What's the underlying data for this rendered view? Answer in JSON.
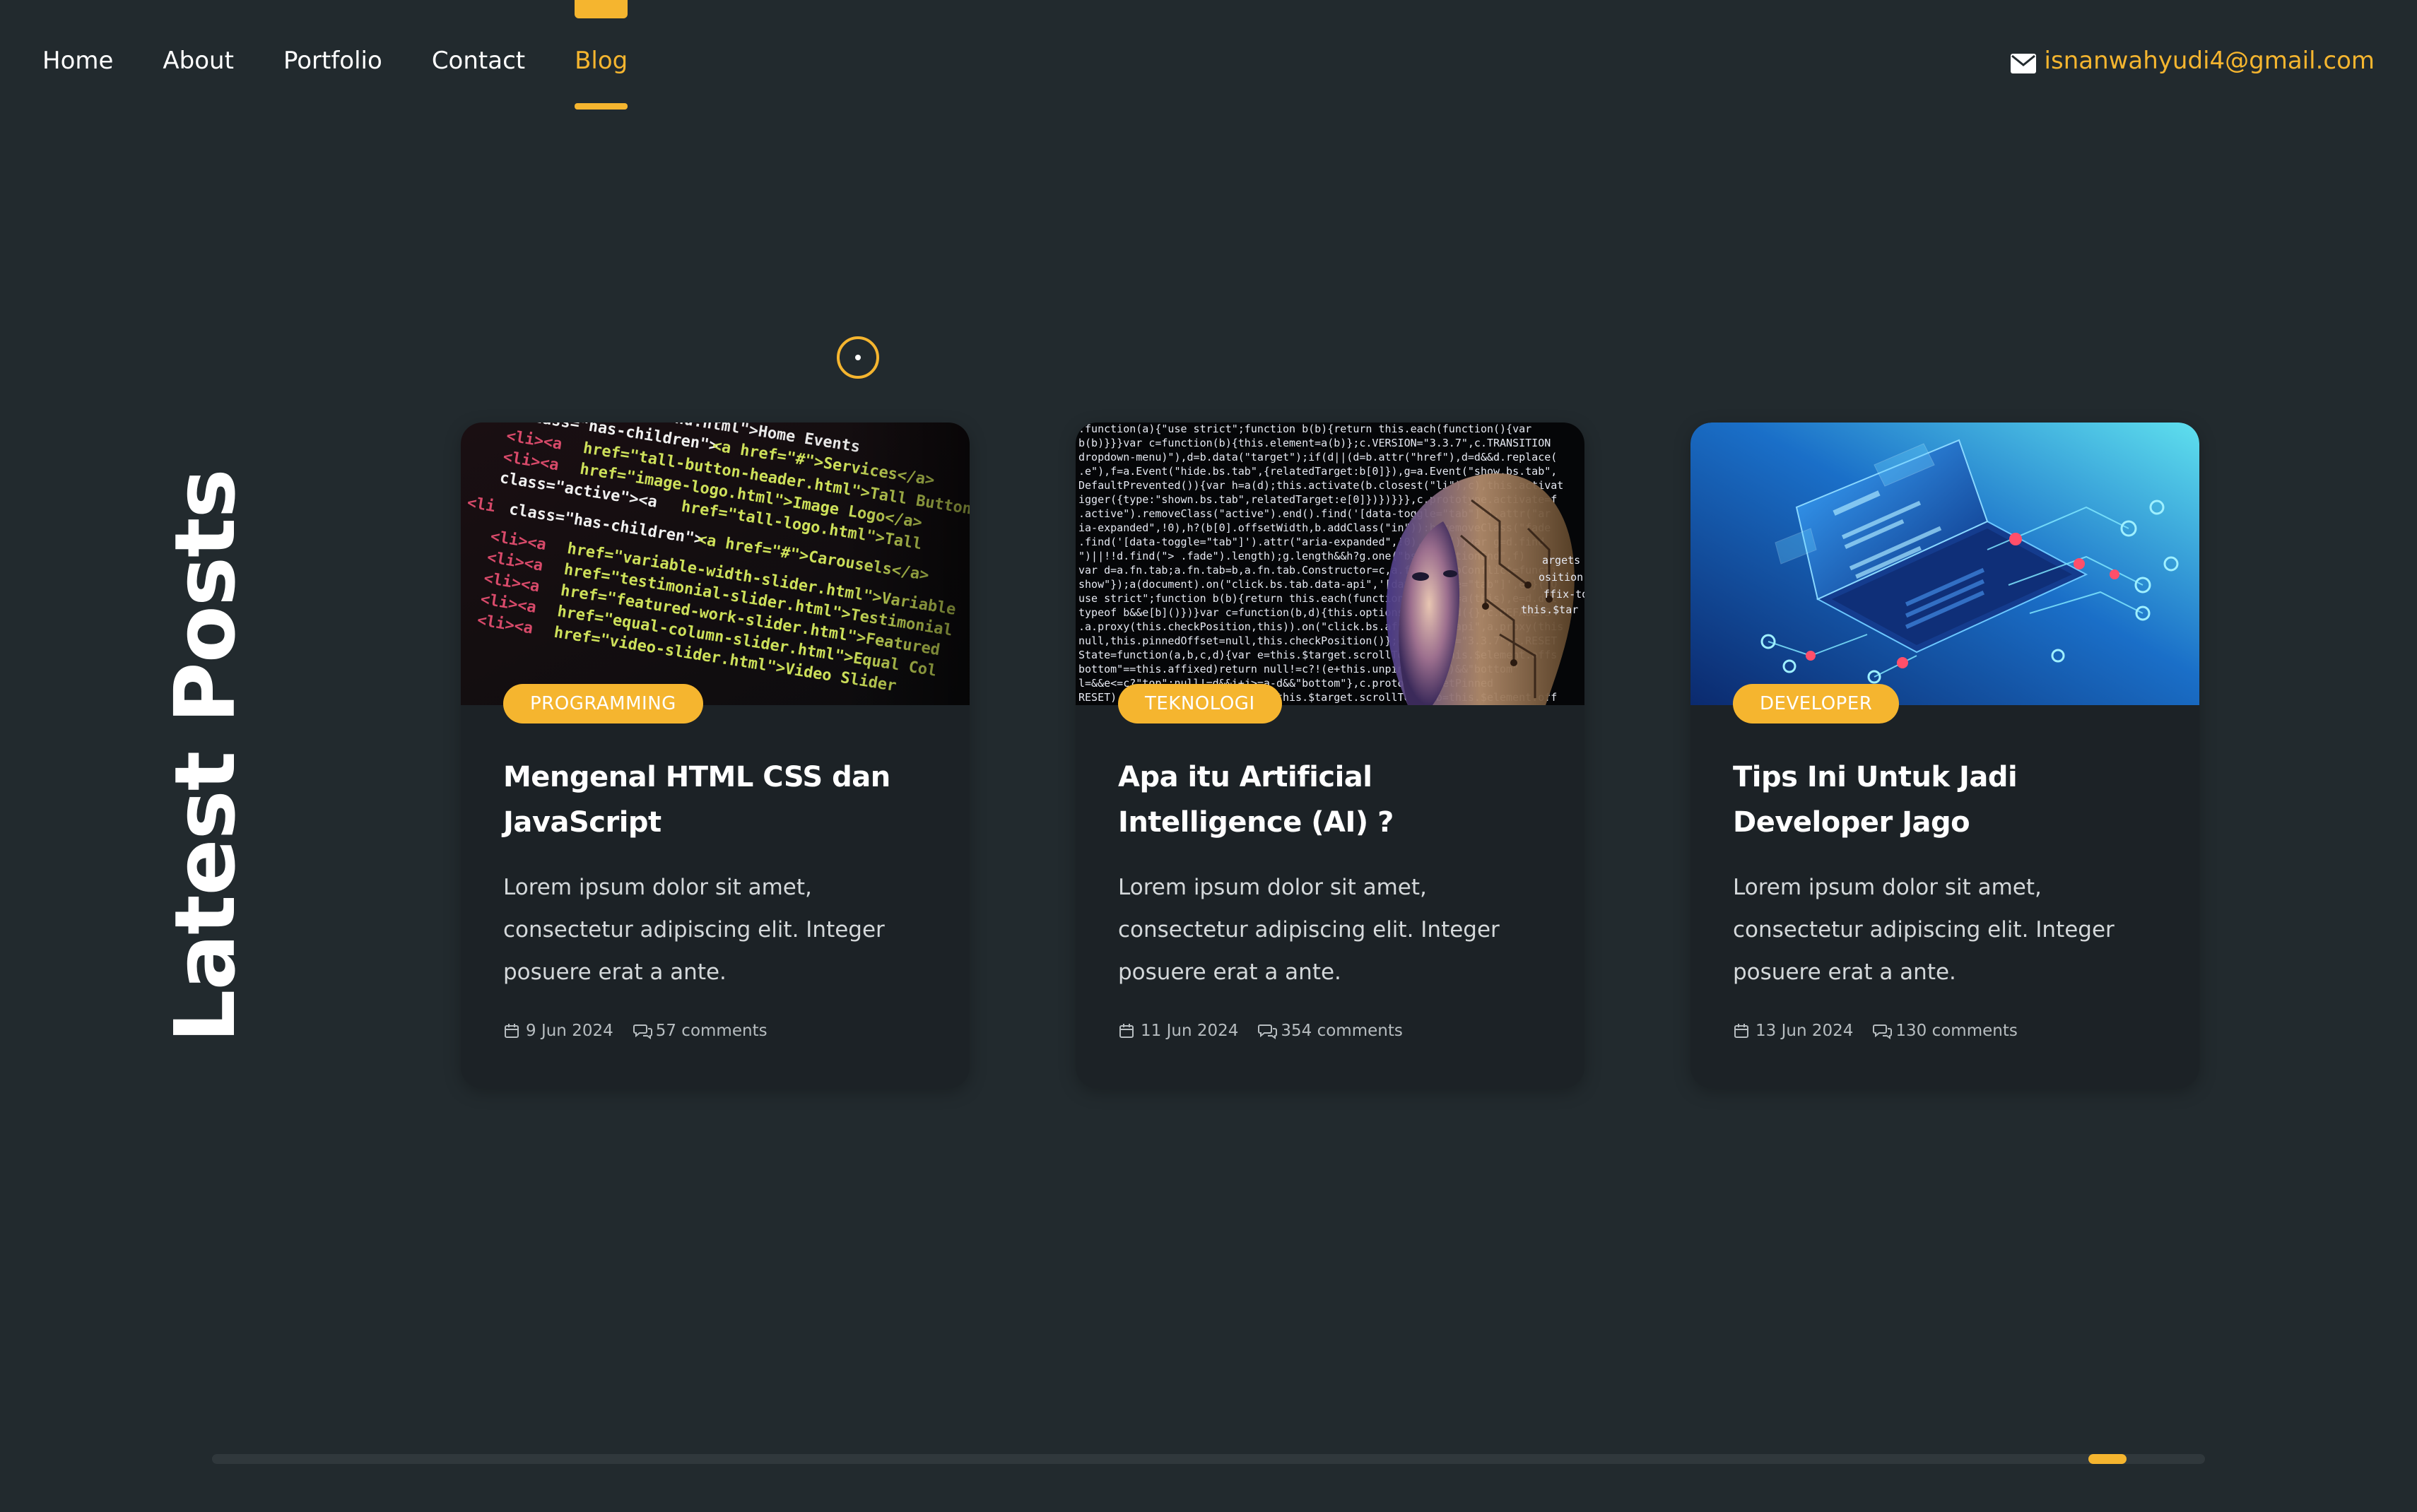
{
  "nav": {
    "links": [
      {
        "label": "Home"
      },
      {
        "label": "About"
      },
      {
        "label": "Portfolio"
      },
      {
        "label": "Contact"
      },
      {
        "label": "Blog"
      }
    ],
    "active_index": 4,
    "email": "isnanwahyudi4@gmail.com",
    "email_icon": "envelope-icon"
  },
  "section": {
    "title": "Latest Posts"
  },
  "posts": [
    {
      "category": "PROGRAMMING",
      "title": "Mengenal HTML CSS dan JavaScript",
      "excerpt": "Lorem ipsum dolor sit amet, consectetur adipiscing elit. Integer posuere erat a ante.",
      "date": "9 Jun 2024",
      "comments": "57 comments",
      "image": "html-code-screen"
    },
    {
      "category": "TEKNOLOGI",
      "title": "Apa itu Artificial Intelligence (AI) ?",
      "excerpt": "Lorem ipsum dolor sit amet, consectetur adipiscing elit. Integer posuere erat a ante.",
      "date": "11 Jun 2024",
      "comments": "354 comments",
      "image": "ai-face-code"
    },
    {
      "category": "DEVELOPER",
      "title": "Tips Ini Untuk Jadi Developer Jago",
      "excerpt": "Lorem ipsum dolor sit amet, consectetur adipiscing elit. Integer posuere erat a ante.",
      "date": "13 Jun 2024",
      "comments": "130 comments",
      "image": "isometric-laptop"
    }
  ],
  "scrollbar": {
    "position": 0.96
  },
  "colors": {
    "background": "#222a2e",
    "card": "#1c2226",
    "accent": "#f5b52f",
    "text": "#ffffff",
    "muted": "#b7bdc0"
  }
}
